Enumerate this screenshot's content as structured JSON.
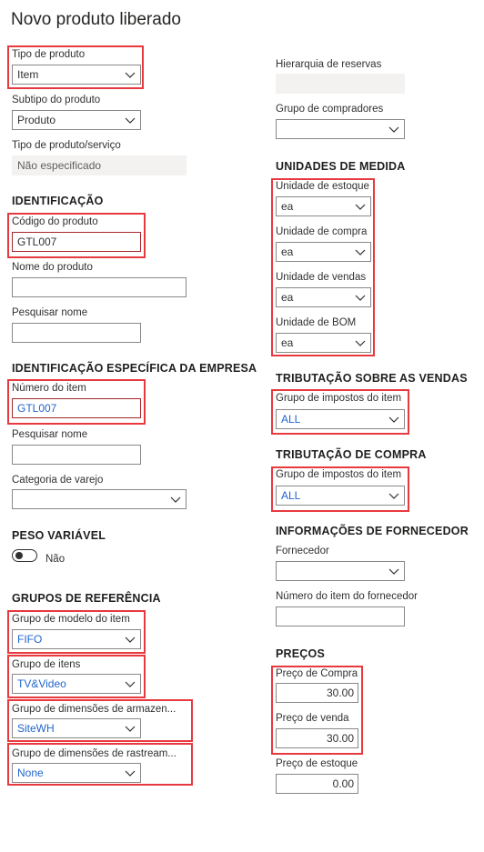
{
  "title": "Novo produto liberado",
  "left": {
    "tipo_produto": {
      "label": "Tipo de produto",
      "value": "Item"
    },
    "subtipo": {
      "label": "Subtipo do produto",
      "value": "Produto"
    },
    "tipo_servico": {
      "label": "Tipo de produto/serviço",
      "value": "Não especificado"
    },
    "identificacao": {
      "header": "IDENTIFICAÇÃO",
      "codigo": {
        "label": "Código do produto",
        "value": "GTL007"
      },
      "nome": {
        "label": "Nome do produto",
        "value": ""
      },
      "pesquisar": {
        "label": "Pesquisar nome",
        "value": ""
      }
    },
    "empresa": {
      "header": "IDENTIFICAÇÃO ESPECÍFICA DA EMPRESA",
      "numero": {
        "label": "Número do item",
        "value": "GTL007"
      },
      "pesquisar": {
        "label": "Pesquisar nome",
        "value": ""
      },
      "categoria": {
        "label": "Categoria de varejo",
        "value": ""
      }
    },
    "peso": {
      "header": "PESO VARIÁVEL",
      "toggle_label": "Não",
      "toggle_on": false
    },
    "grupos": {
      "header": "GRUPOS DE REFERÊNCIA",
      "modelo": {
        "label": "Grupo de modelo do item",
        "value": "FIFO"
      },
      "itens": {
        "label": "Grupo de itens",
        "value": "TV&Video"
      },
      "armazenamento": {
        "label": "Grupo de dimensões de armazen...",
        "value": "SiteWH"
      },
      "rastreamento": {
        "label": "Grupo de dimensões de rastream...",
        "value": "None"
      }
    }
  },
  "right": {
    "hierarquia": {
      "label": "Hierarquia de reservas",
      "value": ""
    },
    "compradores": {
      "label": "Grupo de compradores",
      "value": ""
    },
    "unidades": {
      "header": "UNIDADES DE MEDIDA",
      "estoque": {
        "label": "Unidade de estoque",
        "value": "ea"
      },
      "compra": {
        "label": "Unidade de compra",
        "value": "ea"
      },
      "vendas": {
        "label": "Unidade de vendas",
        "value": "ea"
      },
      "bom": {
        "label": "Unidade de BOM",
        "value": "ea"
      }
    },
    "trib_vendas": {
      "header": "TRIBUTAÇÃO SOBRE AS VENDAS",
      "label": "Grupo de impostos do item",
      "value": "ALL"
    },
    "trib_compra": {
      "header": "TRIBUTAÇÃO DE COMPRA",
      "label": "Grupo de impostos do item",
      "value": "ALL"
    },
    "fornecedor": {
      "header": "INFORMAÇÕES DE FORNECEDOR",
      "fornecedor": {
        "label": "Fornecedor",
        "value": ""
      },
      "numero": {
        "label": "Número do item do fornecedor",
        "value": ""
      }
    },
    "precos": {
      "header": "PREÇOS",
      "compra": {
        "label": "Preço de Compra",
        "value": "30.00"
      },
      "venda": {
        "label": "Preço de venda",
        "value": "30.00"
      },
      "estoque": {
        "label": "Preço de estoque",
        "value": "0.00"
      }
    }
  },
  "colors": {
    "highlight": "#e8393f",
    "link_value": "#2266cc",
    "error_border": "#a4262c"
  }
}
